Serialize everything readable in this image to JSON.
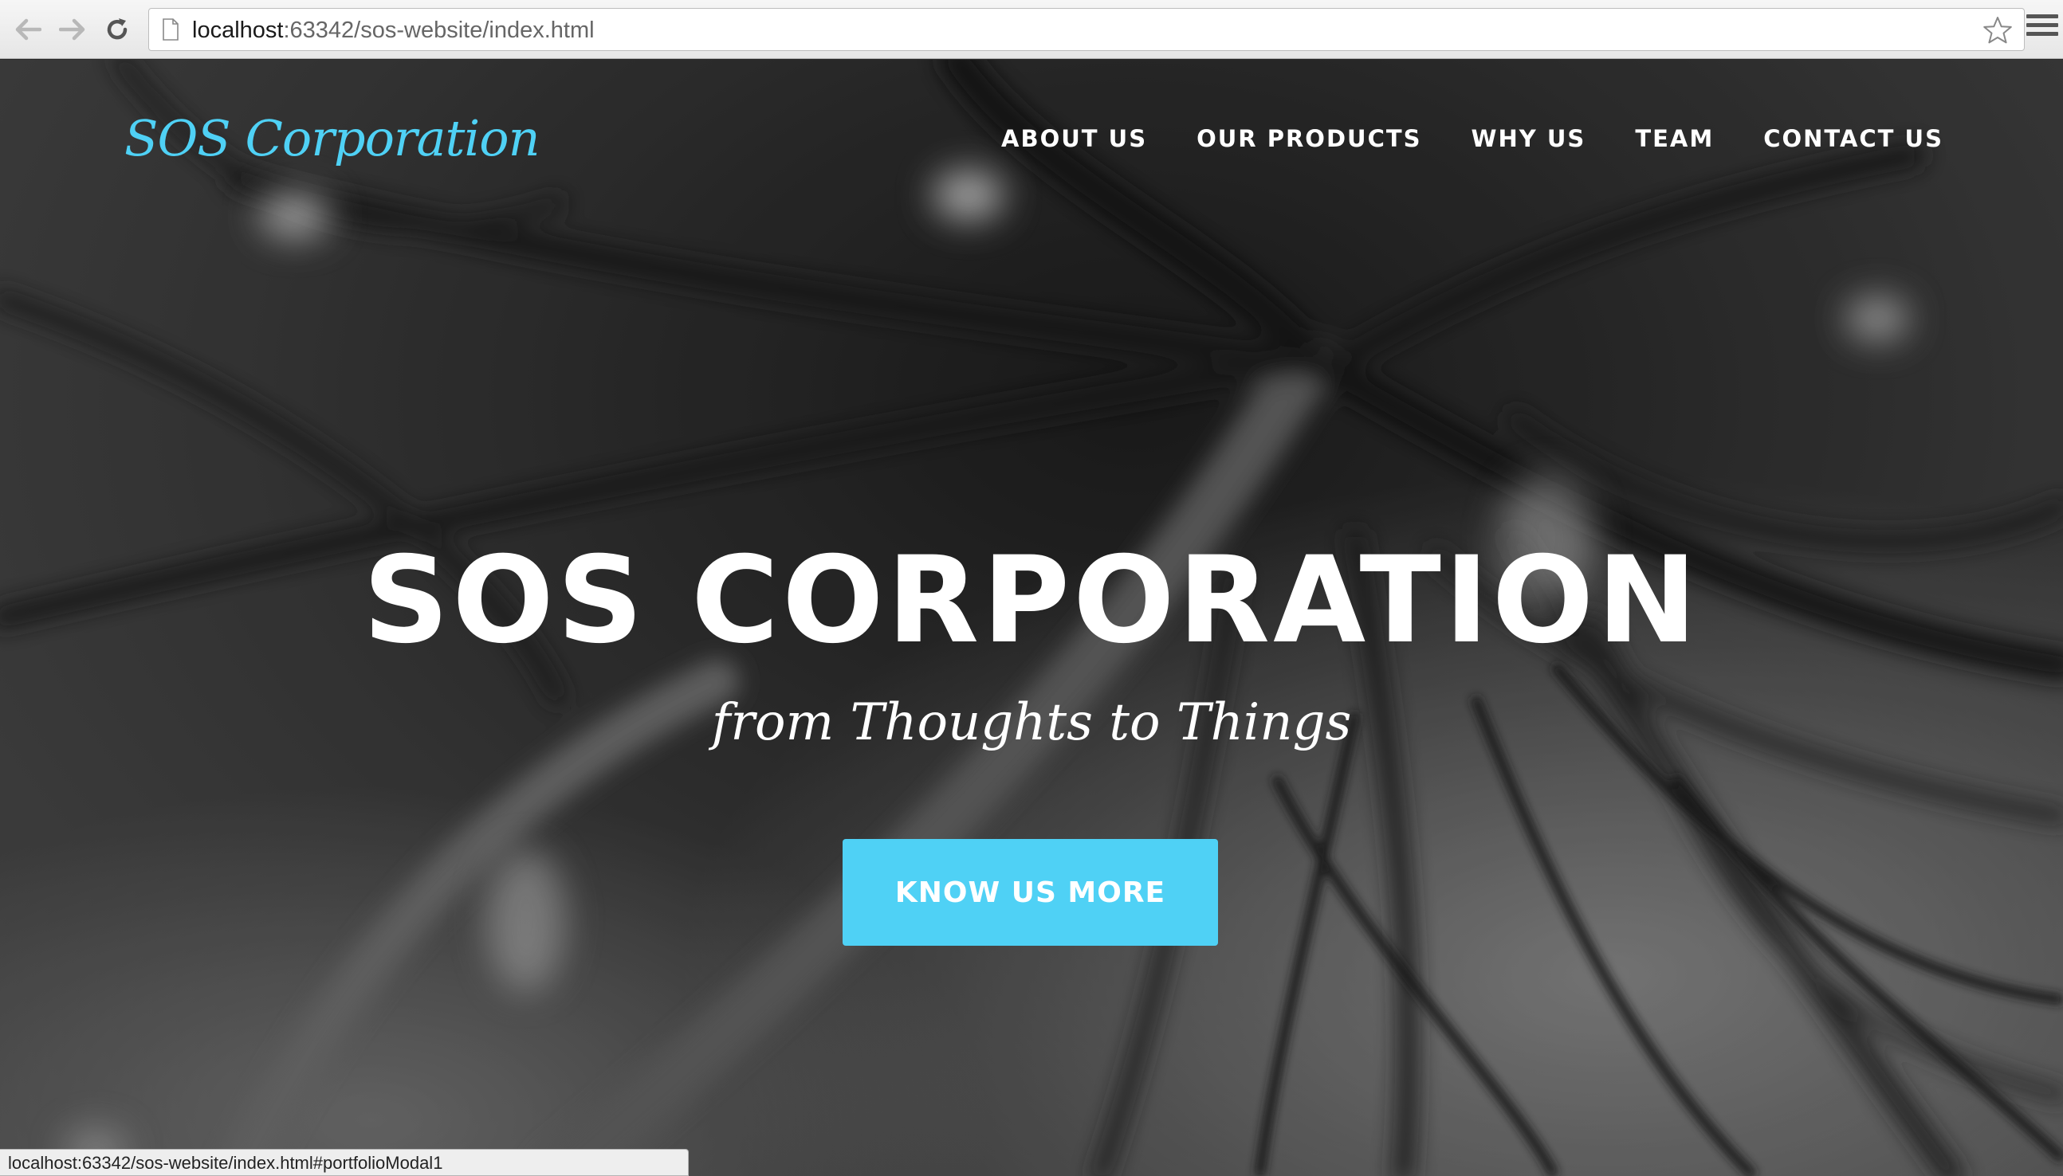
{
  "browser": {
    "url_host": "localhost",
    "url_rest": ":63342/sos-website/index.html",
    "status_url": "localhost:63342/sos-website/index.html#portfolioModal1"
  },
  "site": {
    "brand": "SOS Corporation",
    "nav": [
      "ABOUT US",
      "OUR PRODUCTS",
      "WHY US",
      "TEAM",
      "CONTACT US"
    ],
    "hero_title": "SOS CORPORATION",
    "hero_subtitle": "from Thoughts to Things",
    "cta_label": "KNOW US MORE"
  },
  "colors": {
    "accent": "#4fd1f5",
    "hero_text": "#ffffff",
    "background": "#2a2a2a"
  },
  "icons": [
    "back-arrow-icon",
    "forward-arrow-icon",
    "reload-icon",
    "page-icon",
    "star-icon",
    "menu-icon"
  ]
}
